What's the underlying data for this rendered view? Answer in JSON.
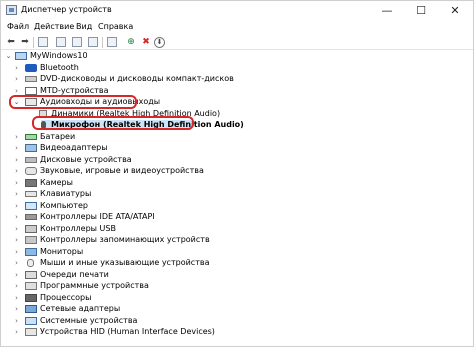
{
  "window": {
    "title": "Диспетчер устройств",
    "controls": {
      "minimize": "—",
      "maximize": "☐",
      "close": "✕"
    }
  },
  "menu": [
    "Файл",
    "Действие",
    "Вид",
    "Справка"
  ],
  "toolbar": {
    "icons": [
      "back-icon",
      "forward-icon",
      "properties-icon",
      "show-list-icon",
      "help-icon",
      "computer-icon",
      "scan-hardware-icon",
      "update-driver-icon",
      "uninstall-icon",
      "download-icon"
    ],
    "glyphs": {
      "back": "⬅",
      "forward": "➡",
      "scan": "⊕",
      "uninstall": "✖",
      "download": "⬇"
    }
  },
  "tree": {
    "root": "MyWindows10",
    "items": [
      {
        "label": "Bluetooth",
        "icon": "bluetooth-icon"
      },
      {
        "label": "DVD-дисководы и дисководы компакт-дисков",
        "icon": "dvd-drive-icon"
      },
      {
        "label": "MTD-устройства",
        "icon": "mtd-device-icon"
      },
      {
        "label": "Аудиовходы и аудиовыходы",
        "icon": "audio-io-icon",
        "expanded": true,
        "children": [
          {
            "label": "Динамики (Realtek High Definition Audio)",
            "icon": "speaker-icon"
          },
          {
            "label": "Микрофон (Realtek High Definition Audio)",
            "icon": "microphone-icon",
            "selected": true
          }
        ]
      },
      {
        "label": "Батареи",
        "icon": "battery-icon"
      },
      {
        "label": "Видеоадаптеры",
        "icon": "video-adapter-icon"
      },
      {
        "label": "Дисковые устройства",
        "icon": "disk-drive-icon"
      },
      {
        "label": "Звуковые, игровые и видеоустройства",
        "icon": "sound-game-video-icon"
      },
      {
        "label": "Камеры",
        "icon": "camera-icon"
      },
      {
        "label": "Клавиатуры",
        "icon": "keyboard-icon"
      },
      {
        "label": "Компьютер",
        "icon": "computer-icon"
      },
      {
        "label": "Контроллеры IDE ATA/ATAPI",
        "icon": "ide-controller-icon"
      },
      {
        "label": "Контроллеры USB",
        "icon": "usb-controller-icon"
      },
      {
        "label": "Контроллеры запоминающих устройств",
        "icon": "storage-controller-icon"
      },
      {
        "label": "Мониторы",
        "icon": "monitor-icon"
      },
      {
        "label": "Мыши и иные указывающие устройства",
        "icon": "mouse-icon"
      },
      {
        "label": "Очереди печати",
        "icon": "print-queue-icon"
      },
      {
        "label": "Программные устройства",
        "icon": "software-device-icon"
      },
      {
        "label": "Процессоры",
        "icon": "processor-icon"
      },
      {
        "label": "Сетевые адаптеры",
        "icon": "network-adapter-icon"
      },
      {
        "label": "Системные устройства",
        "icon": "system-device-icon"
      },
      {
        "label": "Устройства HID (Human Interface Devices)",
        "icon": "hid-device-icon"
      }
    ]
  },
  "highlight_color": "#d62828",
  "selection_color": "#cce4f7"
}
